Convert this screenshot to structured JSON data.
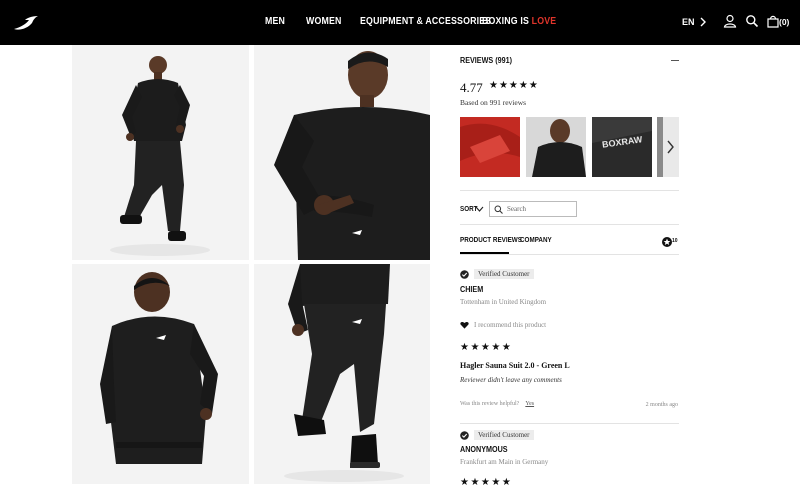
{
  "header": {
    "logo": "brand-swoosh-logo",
    "nav": [
      {
        "label": "MEN"
      },
      {
        "label": "WOMEN"
      },
      {
        "label": "EQUIPMENT & ACCESSORIES"
      },
      {
        "label_main": "BOXING IS ",
        "label_accent": "LOVE"
      }
    ],
    "lang": "EN",
    "bag_count": "(0)",
    "icons": [
      "chevron-right-icon",
      "user-icon",
      "search-icon",
      "bag-icon"
    ],
    "accent_color": "#e0352b"
  },
  "gallery": {
    "images": [
      "model-standing-full-body",
      "model-upper-body-close",
      "model-back-view",
      "model-lower-body-walking"
    ]
  },
  "reviews": {
    "title": "REVIEWS (991)",
    "average": "4.77",
    "average_stars": "★★★★★",
    "based_on": "Based on 991 reviews",
    "thumbnails": [
      "red-fabric-photo",
      "model-photo",
      "boxraw-logo-photo",
      "grey-photo"
    ],
    "sort_label": "SORT",
    "search_placeholder": "Search",
    "tabs": [
      {
        "label": "PRODUCT REVIEWS",
        "active": true
      },
      {
        "label": "COMPANY",
        "active": false
      }
    ],
    "tab_badge": "10",
    "items": [
      {
        "verified": "Verified Customer",
        "name": "CHIEM",
        "location": "Tottenham in United Kingdom",
        "recommend": "I recommend this product",
        "stars": "★★★★★",
        "product": "Hagler Sauna Suit 2.0 - Green L",
        "body": "Reviewer didn't leave any comments",
        "helpful": "Was this review helpful?",
        "helpful_yes": "Yes",
        "date": "2 months ago"
      },
      {
        "verified": "Verified Customer",
        "name": "ANONYMOUS",
        "location": "Frankfurt am Main in Germany",
        "stars": "★★★★★"
      }
    ]
  }
}
